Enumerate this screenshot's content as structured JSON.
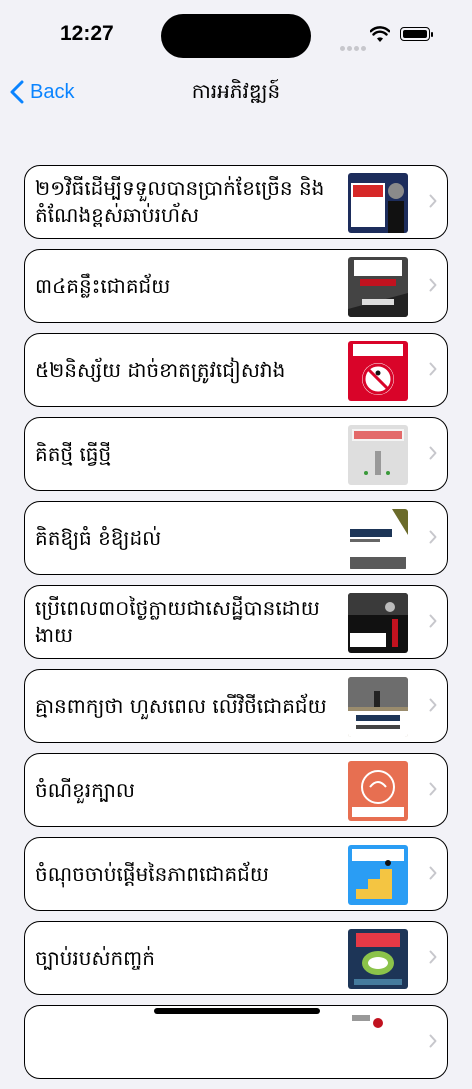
{
  "status": {
    "time": "12:27"
  },
  "nav": {
    "back_label": "Back",
    "title": "ការអភិវឌ្ឍន៍"
  },
  "colors": {
    "accent": "#0a84ff",
    "background": "#f2f2f7",
    "card": "#ffffff"
  },
  "list": {
    "items": [
      {
        "label": "២១វិធីដើម្បីទទួលបានប្រាក់ខែច្រើន និងតំណែងខ្ពស់ឆាប់រហ័ស",
        "icon": "book-cover-thumbnail"
      },
      {
        "label": "៣៤គន្លឹះជោគជ័យ",
        "icon": "book-cover-thumbnail"
      },
      {
        "label": "៥២និស្ស័យ ដាច់ខាតត្រូវជៀសវាង",
        "icon": "book-cover-thumbnail"
      },
      {
        "label": "គិតថ្មី ធ្វើថ្មី",
        "icon": "book-cover-thumbnail"
      },
      {
        "label": "គិតឱ្យធំ ខំឱ្យដល់",
        "icon": "book-cover-thumbnail"
      },
      {
        "label": "ប្រើពេល៣០ថ្ងៃក្លាយជាសេដ្ឋីបានដោយងាយ",
        "icon": "book-cover-thumbnail"
      },
      {
        "label": "គ្មានពាក្យថា ហួសពេល លើវិថីជោគជ័យ",
        "icon": "book-cover-thumbnail"
      },
      {
        "label": "ចំណីខួរក្បាល",
        "icon": "book-cover-thumbnail"
      },
      {
        "label": "ចំណុចចាប់ផ្ដើមនៃភាពជោគជ័យ",
        "icon": "book-cover-thumbnail"
      },
      {
        "label": "ច្បាប់របស់កញ្ចក់",
        "icon": "book-cover-thumbnail"
      },
      {
        "label": "",
        "icon": "book-cover-thumbnail"
      }
    ]
  }
}
